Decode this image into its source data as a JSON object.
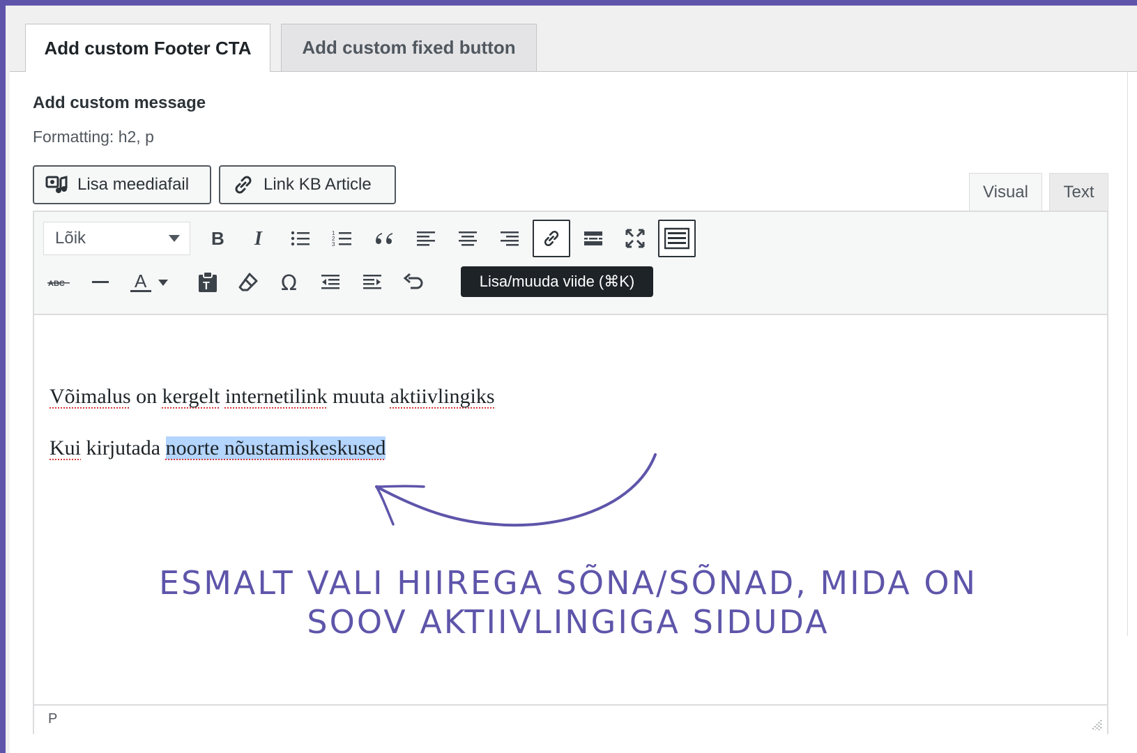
{
  "tabs": [
    {
      "label": "Add custom Footer CTA",
      "active": true
    },
    {
      "label": "Add custom fixed button",
      "active": false
    }
  ],
  "field": {
    "label": "Add custom message",
    "hint": "Formatting: h2, p"
  },
  "buttons": {
    "media": "Lisa meediafail",
    "link_kb": "Link KB Article"
  },
  "mode_tabs": {
    "visual": "Visual",
    "text": "Text"
  },
  "toolbar": {
    "format_select": "Lõik",
    "row1_icons": [
      "bold-icon",
      "italic-icon",
      "bullet-list-icon",
      "numbered-list-icon",
      "blockquote-icon",
      "align-left-icon",
      "align-center-icon",
      "align-right-icon",
      "link-icon",
      "read-more-icon",
      "fullscreen-icon",
      "toolbar-toggle-icon"
    ],
    "row2_icons": [
      "strikethrough-icon",
      "horizontal-line-icon",
      "text-color-icon",
      "text-color-dropdown-icon",
      "paste-text-icon",
      "clear-formatting-icon",
      "special-character-icon",
      "outdent-icon",
      "indent-icon",
      "undo-icon"
    ],
    "tooltip": "Lisa/muuda viide (⌘K)"
  },
  "content": {
    "p1_words": [
      "Võimalus",
      "on",
      "kergelt",
      "internetilink",
      "muuta",
      "aktiivlingiks"
    ],
    "p2_before": "Kui",
    "p2_mid": "kirjutada",
    "p2_selected": "noorte nõustamiskeskused"
  },
  "statusbar": {
    "path": "P"
  },
  "annotation": {
    "line1": "ESMALT VALI HIIREGA SÕNA/SÕNAD, MIDA ON",
    "line2": "SOOV AKTIIVLINGIGA SIDUDA"
  },
  "colors": {
    "accent": "#5e55aa",
    "selection": "#b4d5fe",
    "spellcheck": "#d63638"
  }
}
